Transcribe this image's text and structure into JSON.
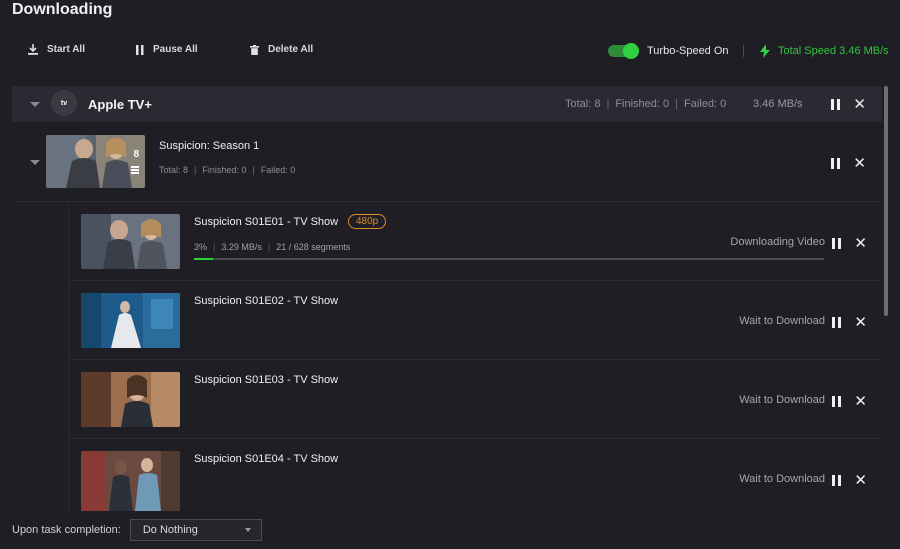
{
  "window_title": "Downloading",
  "toolbar": {
    "start_all": "Start All",
    "pause_all": "Pause All",
    "delete_all": "Delete All",
    "turbo_label": "Turbo-Speed On",
    "turbo_on": true,
    "total_speed": "Total Speed 3.46 MB/s"
  },
  "group": {
    "logo_text": "tv",
    "name": "Apple TV+",
    "total": "Total: 8",
    "finished": "Finished: 0",
    "failed": "Failed: 0",
    "speed": "3.46 MB/s"
  },
  "season": {
    "title": "Suspicion: Season 1",
    "count_badge": "8",
    "total": "Total: 8",
    "finished": "Finished: 0",
    "failed": "Failed: 0"
  },
  "episodes": [
    {
      "title": "Suspicion S01E01 - TV Show",
      "resolution": "480p",
      "percent": "3%",
      "speed": "3.29 MB/s",
      "segments": "21 / 628 segments",
      "progress": 0.03,
      "status": "Downloading Video"
    },
    {
      "title": "Suspicion S01E02 - TV Show",
      "status": "Wait to Download"
    },
    {
      "title": "Suspicion S01E03 - TV Show",
      "status": "Wait to Download"
    },
    {
      "title": "Suspicion S01E04 - TV Show",
      "status": "Wait to Download"
    }
  ],
  "footer": {
    "label": "Upon task completion:",
    "selected": "Do Nothing"
  },
  "colors": {
    "accent_green": "#2fd140",
    "badge_orange": "#e08a2a",
    "background": "#1e1e24"
  }
}
